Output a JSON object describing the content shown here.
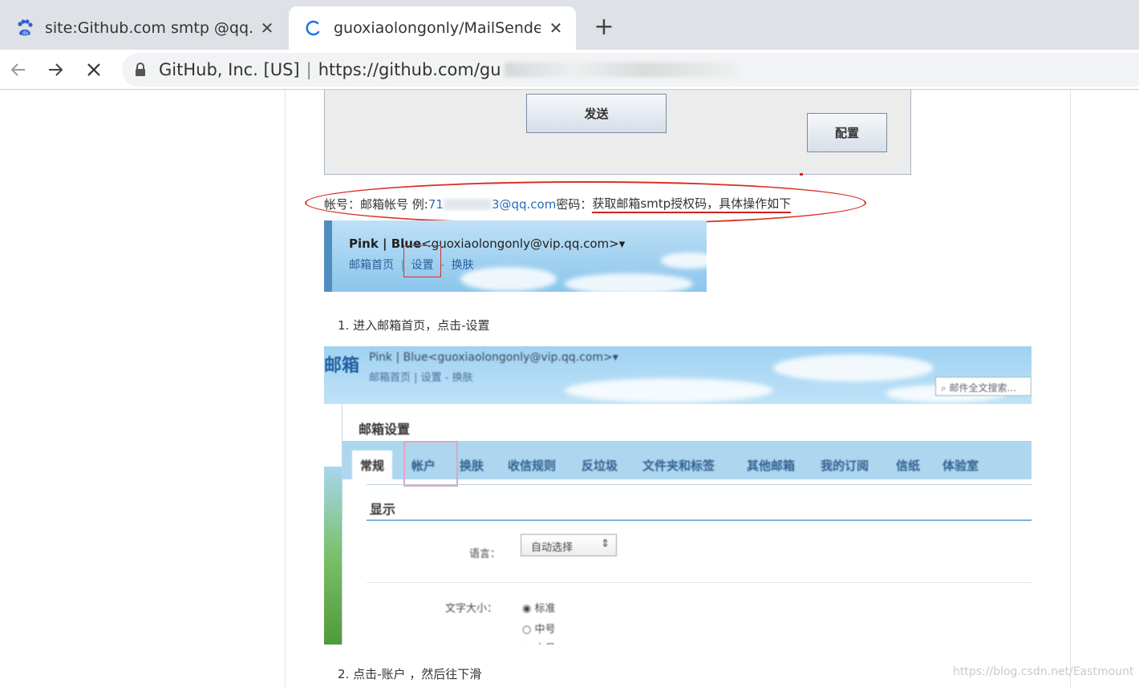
{
  "browser": {
    "tabs": [
      {
        "title": "site:Github.com smtp @qq.cor",
        "icon": "baidu-paw-icon",
        "active": false
      },
      {
        "title": "guoxiaolongonly/MailSender: ",
        "icon": "loading-spinner-icon",
        "active": true
      }
    ],
    "new_tab_icon": "plus-icon",
    "nav": {
      "back_icon": "back-arrow-icon",
      "forward_icon": "forward-arrow-icon",
      "stop_icon": "stop-x-icon"
    },
    "omnibox": {
      "org": "GitHub, Inc. [US]",
      "separator": "|",
      "url": "https://github.com/gu"
    }
  },
  "app_window": {
    "send_label": "发送",
    "config_label": "配置"
  },
  "instruction": {
    "account_label": "帐号：邮箱帐号 例:",
    "email_prefix": "71",
    "email_suffix": "3@qq.com",
    "password_label": " 密码：",
    "password_text": "获取邮箱smtp授权码，具体操作如下"
  },
  "mail_header": {
    "name_bold": "Pink | Blue",
    "email": "<guoxiaolongonly@vip.qq.com>",
    "dropdown_glyph": "▾",
    "links": [
      "邮箱首页",
      "设置",
      "换肤"
    ],
    "link_sep": "|",
    "link_sep2": "-"
  },
  "steps": [
    "1. 进入邮箱首页，点击-设置",
    "2. 点击-账户 ，然后往下滑"
  ],
  "settings_screenshot": {
    "logo": "邮箱",
    "name": "Pink | Blue<guoxiaolongonly@vip.qq.com>▾",
    "links": "邮箱首页 | 设置 - 换肤",
    "search_placeholder": "邮件全文搜索...",
    "title": "邮箱设置",
    "tabs": [
      "常规",
      "帐户",
      "换肤",
      "收信规则",
      "反垃圾",
      "文件夹和标签",
      "其他邮箱",
      "我的订阅",
      "信纸",
      "体验室"
    ],
    "section": "显示",
    "language_label": "语言：",
    "language_value": "自动选择",
    "font_label": "文字大小：",
    "font_options": [
      "标准",
      "中号",
      "大号"
    ]
  },
  "watermark": "https://blog.csdn.net/Eastmount"
}
